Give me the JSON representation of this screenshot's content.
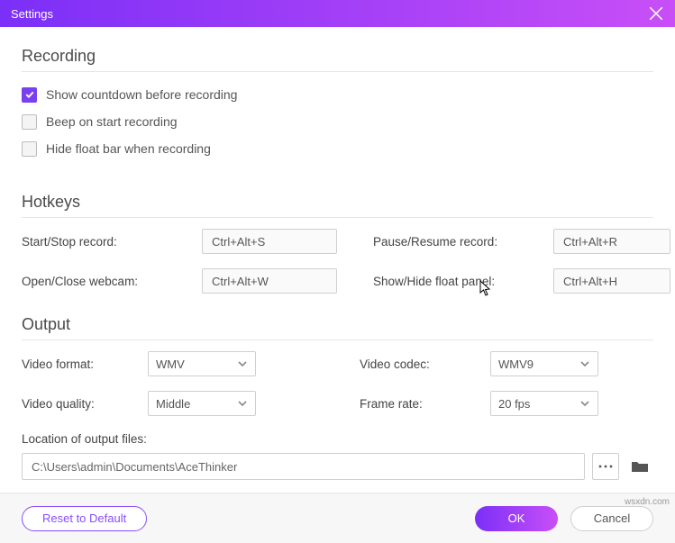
{
  "title": "Settings",
  "sections": {
    "recording": {
      "title": "Recording",
      "items": [
        {
          "label": "Show countdown before recording",
          "checked": true
        },
        {
          "label": "Beep on start recording",
          "checked": false
        },
        {
          "label": "Hide float bar when recording",
          "checked": false
        }
      ]
    },
    "hotkeys": {
      "title": "Hotkeys",
      "startStop": {
        "label": "Start/Stop record:",
        "value": "Ctrl+Alt+S"
      },
      "pauseResume": {
        "label": "Pause/Resume record:",
        "value": "Ctrl+Alt+R"
      },
      "webcam": {
        "label": "Open/Close webcam:",
        "value": "Ctrl+Alt+W"
      },
      "floatPanel": {
        "label": "Show/Hide float panel:",
        "value": "Ctrl+Alt+H"
      }
    },
    "output": {
      "title": "Output",
      "videoFormat": {
        "label": "Video format:",
        "value": "WMV"
      },
      "videoCodec": {
        "label": "Video codec:",
        "value": "WMV9"
      },
      "videoQuality": {
        "label": "Video quality:",
        "value": "Middle"
      },
      "frameRate": {
        "label": "Frame rate:",
        "value": "20 fps"
      },
      "locationLabel": "Location of output files:",
      "locationPath": "C:\\Users\\admin\\Documents\\AceThinker"
    }
  },
  "footer": {
    "reset": "Reset to Default",
    "ok": "OK",
    "cancel": "Cancel"
  },
  "watermark": "wsxdn.com"
}
